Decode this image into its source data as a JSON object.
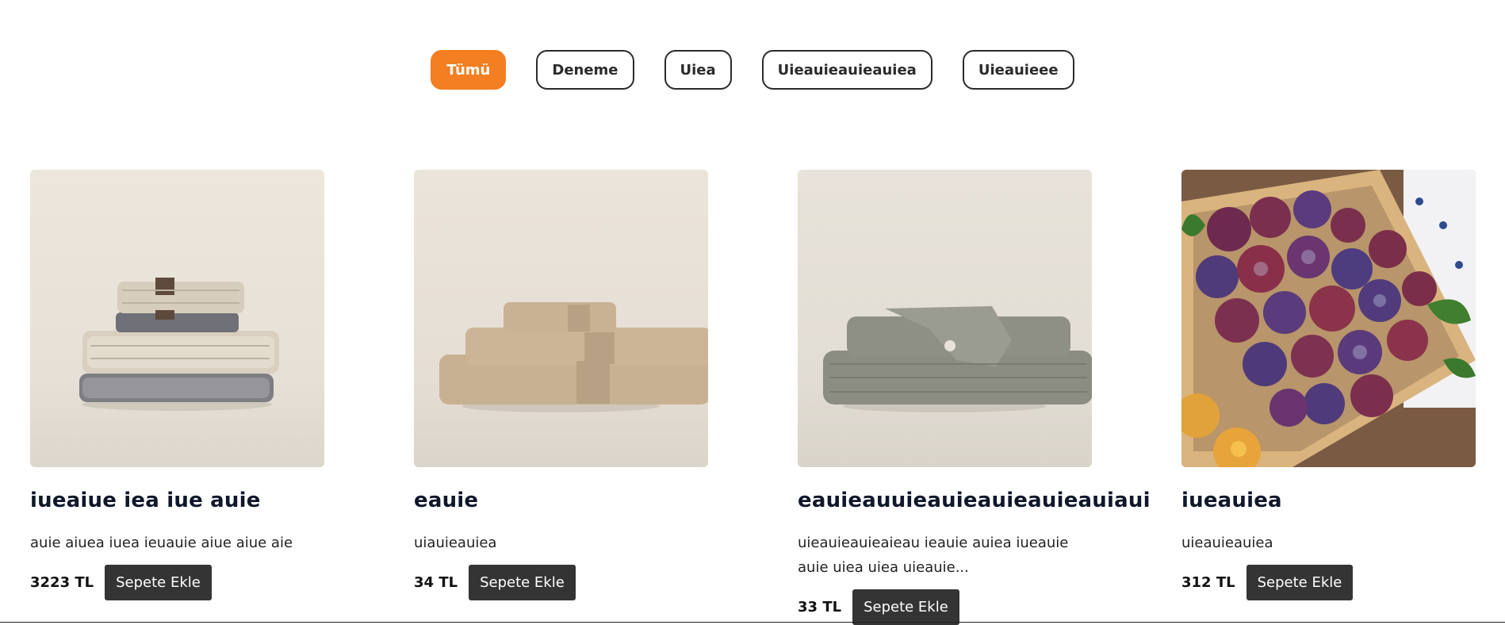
{
  "filters": [
    {
      "label": "Tümü",
      "active": true
    },
    {
      "label": "Deneme",
      "active": false
    },
    {
      "label": "Uiea",
      "active": false
    },
    {
      "label": "Uieauieauieauiea",
      "active": false
    },
    {
      "label": "Uieauieee",
      "active": false
    }
  ],
  "colors": {
    "accent": "#f37f22",
    "button": "#343434"
  },
  "products": [
    {
      "title": "iueaiue iea iue auie",
      "description": "auie aiuea iuea ieuauie aiue aiue aie",
      "price": "3223 TL",
      "cart_label": "Sepete Ekle",
      "image": "towel-stack-grey-image"
    },
    {
      "title": "eauie",
      "description": "uiauieauiea",
      "price": "34 TL",
      "cart_label": "Sepete Ekle",
      "image": "towel-stack-beige-image"
    },
    {
      "title": "eauieauuieauieauieauieauiaui",
      "description": "uieauieauieaieau ieauie auiea iueauie auie uiea uiea uieauie...",
      "price": "33 TL",
      "cart_label": "Sepete Ekle",
      "image": "towel-stack-green-image"
    },
    {
      "title": "iueauiea",
      "description": "uieauieauiea",
      "price": "312 TL",
      "cart_label": "Sepete Ekle",
      "image": "plums-crate-image"
    }
  ]
}
